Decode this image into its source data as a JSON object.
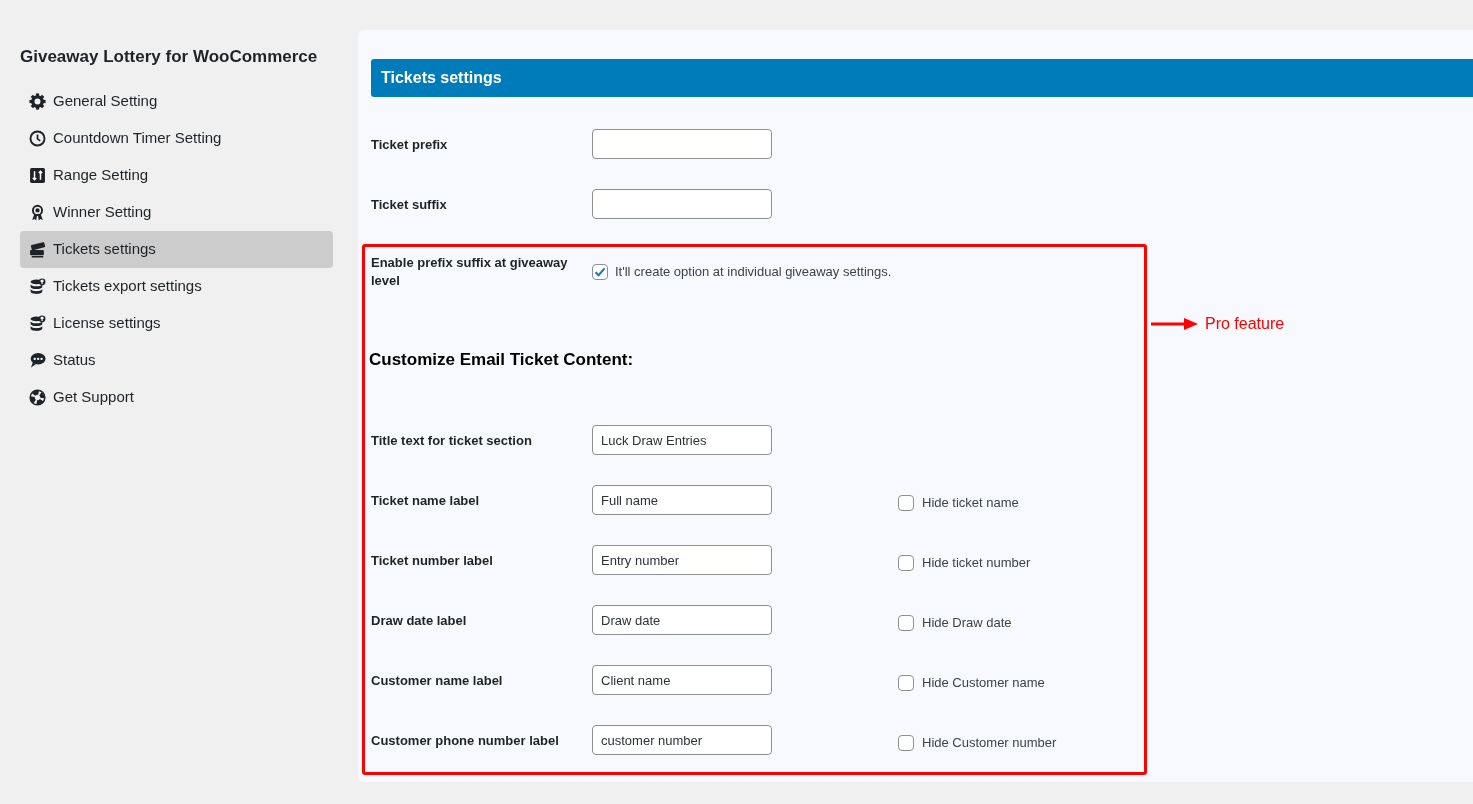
{
  "sidebar": {
    "title": "Giveaway Lottery for WooCommerce",
    "items": [
      {
        "label": "General Setting",
        "selected": false
      },
      {
        "label": "Countdown Timer Setting",
        "selected": false
      },
      {
        "label": "Range Setting",
        "selected": false
      },
      {
        "label": "Winner Setting",
        "selected": false
      },
      {
        "label": "Tickets settings",
        "selected": true
      },
      {
        "label": "Tickets export settings",
        "selected": false
      },
      {
        "label": "License settings",
        "selected": false
      },
      {
        "label": "Status",
        "selected": false
      },
      {
        "label": "Get Support",
        "selected": false
      }
    ]
  },
  "panel": {
    "title": "Tickets settings",
    "fields": [
      {
        "label": "Ticket prefix"
      },
      {
        "label": "Ticket suffix"
      }
    ],
    "pro_section": {
      "enable_option": {
        "label": "Enable prefix suffix at giveaway level",
        "checked": true,
        "description": "It'll create option at individual giveaway settings."
      },
      "heading": "Customize Email Ticket Content:",
      "fields": [
        {
          "label": "Title text for ticket section",
          "value": "Luck Draw Entries"
        },
        {
          "label": "Ticket name label",
          "value": "Full name",
          "hide_option": {
            "label": "Hide ticket name",
            "checked": false
          }
        },
        {
          "label": "Ticket number label",
          "value": "Entry number",
          "hide_option": {
            "label": "Hide ticket number",
            "checked": false
          }
        },
        {
          "label": "Draw date label",
          "value": "Draw date",
          "hide_option": {
            "label": "Hide Draw date",
            "checked": false
          }
        },
        {
          "label": "Customer name label",
          "value": "Client name",
          "hide_option": {
            "label": "Hide Customer name",
            "checked": false
          }
        },
        {
          "label": "Customer phone number label",
          "value": "customer number",
          "hide_option": {
            "label": "Hide Customer number",
            "checked": false
          }
        }
      ],
      "annotation": "Pro feature"
    }
  }
}
